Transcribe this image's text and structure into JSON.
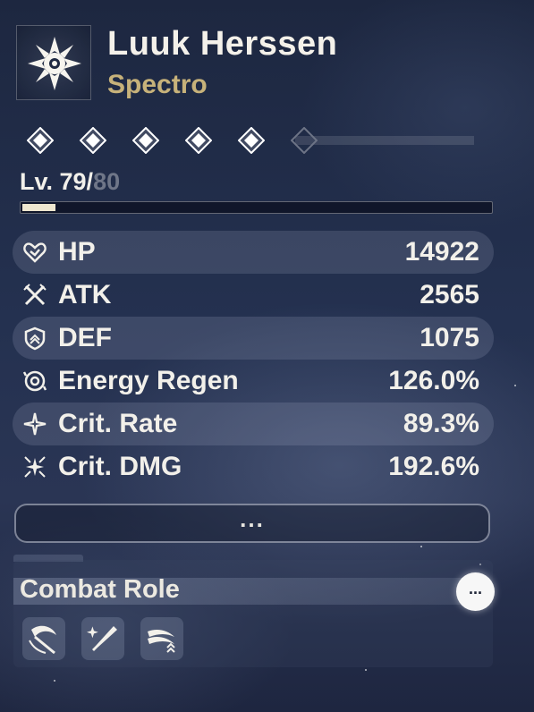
{
  "character": {
    "name": "Luuk Herssen",
    "element": "Spectro",
    "element_icon": "spectro-sun-icon"
  },
  "sequence_nodes": {
    "total": 6,
    "unlocked": 5
  },
  "level": {
    "prefix": "Lv. ",
    "current": "79/",
    "max": "80",
    "progress_fraction": 0.07
  },
  "stats": [
    {
      "label": "HP",
      "value": "14922",
      "icon": "heart-icon"
    },
    {
      "label": "ATK",
      "value": "2565",
      "icon": "crossed-swords-icon"
    },
    {
      "label": "DEF",
      "value": "1075",
      "icon": "shield-icon"
    },
    {
      "label": "Energy Regen",
      "value": "126.0%",
      "icon": "energy-regen-icon"
    },
    {
      "label": "Crit. Rate",
      "value": "89.3%",
      "icon": "crit-rate-icon"
    },
    {
      "label": "Crit. DMG",
      "value": "192.6%",
      "icon": "crit-dmg-icon"
    }
  ],
  "more_button": {
    "label": "..."
  },
  "combat_role": {
    "title": "Combat Role",
    "more_label": "...",
    "roles": [
      {
        "icon": "scythe-slash-icon"
      },
      {
        "icon": "sword-sparkle-icon"
      },
      {
        "icon": "dash-boost-icon"
      }
    ]
  },
  "colors": {
    "element_accent": "#c7b27a",
    "level_max": "#6f7688",
    "text": "#f2f0ea"
  }
}
